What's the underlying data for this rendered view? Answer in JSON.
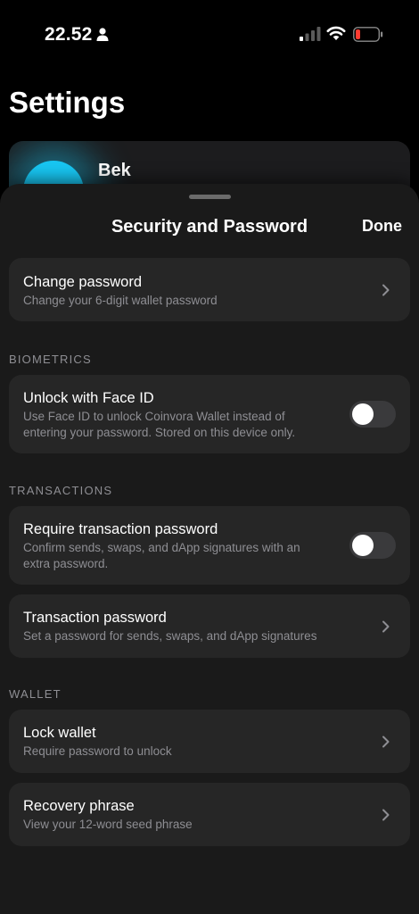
{
  "status_bar": {
    "time": "22.52"
  },
  "background_page": {
    "title": "Settings",
    "profile": {
      "name": "Bek",
      "avatar_color": "#18c6f2"
    }
  },
  "sheet": {
    "title": "Security and Password",
    "done_label": "Done",
    "change_password": {
      "title": "Change password",
      "subtitle": "Change your 6-digit wallet password"
    },
    "biometrics": {
      "section_label": "BIOMETRICS",
      "face_id": {
        "title": "Unlock with Face ID",
        "subtitle_line1": "Use Face ID to unlock Coinvora Wallet instead of",
        "subtitle_line2": "entering your password. Stored on this device only.",
        "enabled": false
      }
    },
    "transactions": {
      "section_label": "TRANSACTIONS",
      "require_password": {
        "title": "Require transaction password",
        "subtitle_line1": "Confirm sends, swaps, and dApp signatures with an",
        "subtitle_line2": "extra password.",
        "enabled": false
      },
      "transaction_password": {
        "title": "Transaction password",
        "subtitle": "Set a password for sends, swaps, and dApp signatures"
      }
    },
    "wallet": {
      "section_label": "WALLET",
      "lock_wallet": {
        "title": "Lock wallet",
        "subtitle": "Require password to unlock"
      },
      "recovery_phrase": {
        "title": "Recovery phrase",
        "subtitle": "View your 12-word seed phrase"
      }
    }
  }
}
